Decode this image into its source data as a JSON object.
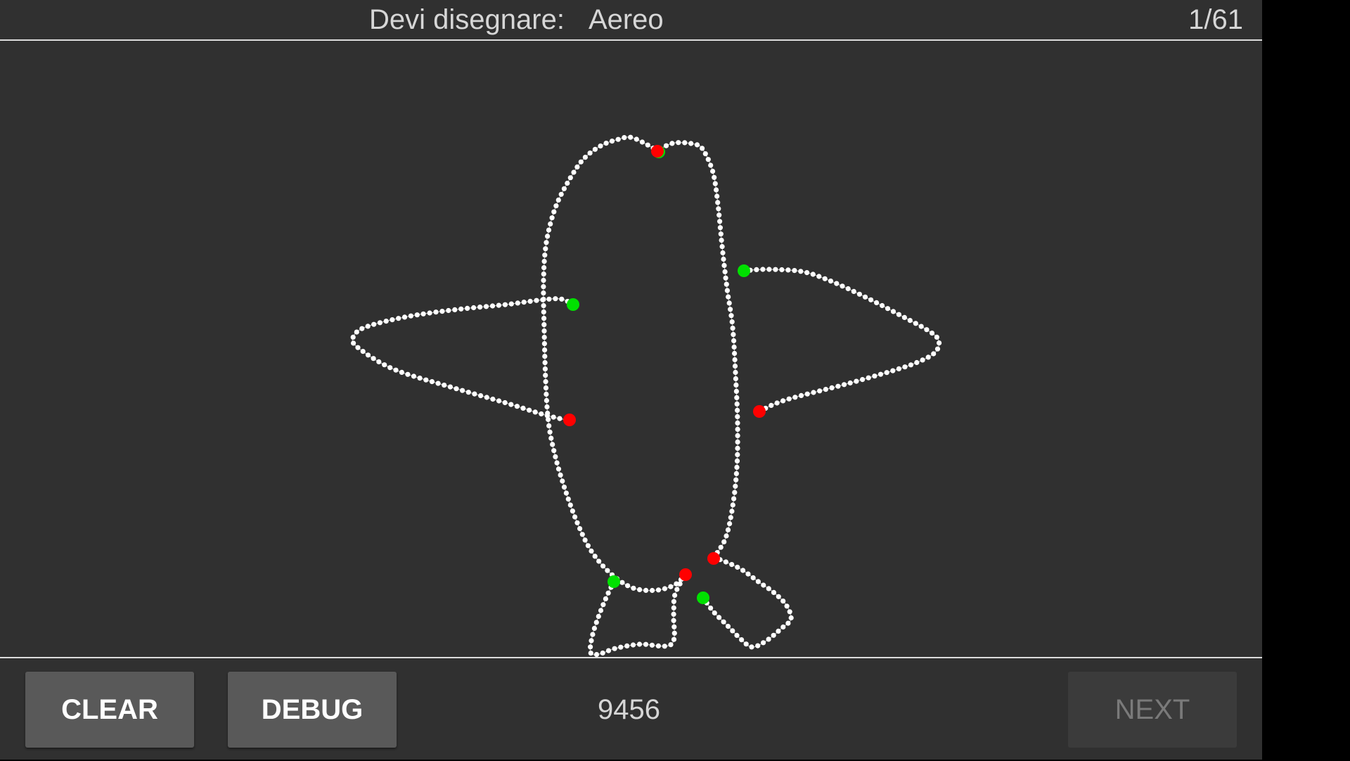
{
  "header": {
    "prompt_label": "Devi disegnare:",
    "prompt_word": "Aereo",
    "counter": "1/61"
  },
  "footer": {
    "clear_label": "CLEAR",
    "debug_label": "DEBUG",
    "score": "9456",
    "next_label": "NEXT"
  },
  "drawing": {
    "point_color": "#ffffff",
    "start_marker_color": "#00e000",
    "end_marker_color": "#ff0000"
  },
  "colors": {
    "background": "#303030",
    "button": "#595959",
    "button_disabled": "#3b3b3b"
  }
}
